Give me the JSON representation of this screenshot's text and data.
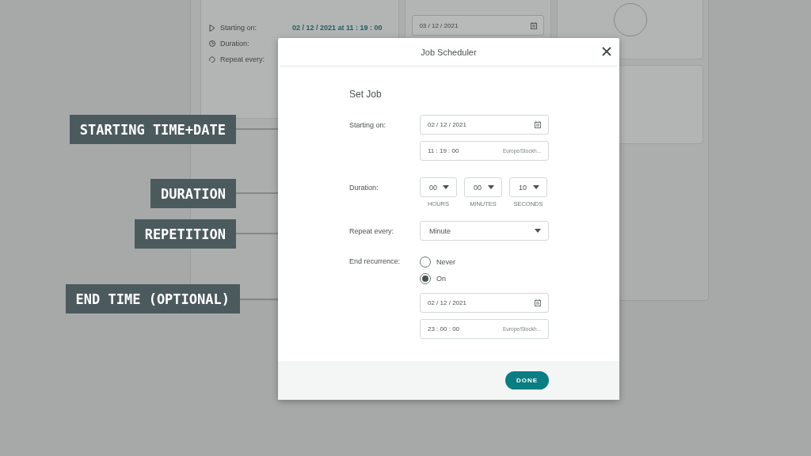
{
  "background_app": {
    "summary": [
      {
        "label": "Starting on:",
        "value": "02 / 12 / 2021 at 11 : 19 : 00"
      },
      {
        "label": "Duration:"
      },
      {
        "label": "Repeat every:"
      }
    ],
    "date_field": {
      "value": "03 / 12 / 2021"
    }
  },
  "dialog": {
    "title": "Job Scheduler",
    "section_title": "Set Job",
    "starting_on": {
      "label": "Starting on:",
      "date": "02 / 12 / 2021",
      "time": "11 : 19 : 00",
      "timezone": "Europe/Stockh..."
    },
    "duration": {
      "label": "Duration:",
      "parts": [
        {
          "value": "00",
          "caption": "HOURS"
        },
        {
          "value": "00",
          "caption": "MINUTES"
        },
        {
          "value": "10",
          "caption": "SECONDS"
        }
      ]
    },
    "repeat": {
      "label": "Repeat every:",
      "value": "Minute"
    },
    "end_recurrence": {
      "label": "End recurrence:",
      "options": [
        {
          "label": "Never",
          "selected": false
        },
        {
          "label": "On",
          "selected": true
        }
      ],
      "date": "02 / 12 / 2021",
      "time": "23 : 00 : 00",
      "timezone": "Europe/Stockh..."
    },
    "done_button": "DONE"
  },
  "annotations": [
    {
      "label": "STARTING TIME+DATE"
    },
    {
      "label": "DURATION"
    },
    {
      "label": "REPETITION"
    },
    {
      "label": "END TIME (OPTIONAL)"
    }
  ]
}
